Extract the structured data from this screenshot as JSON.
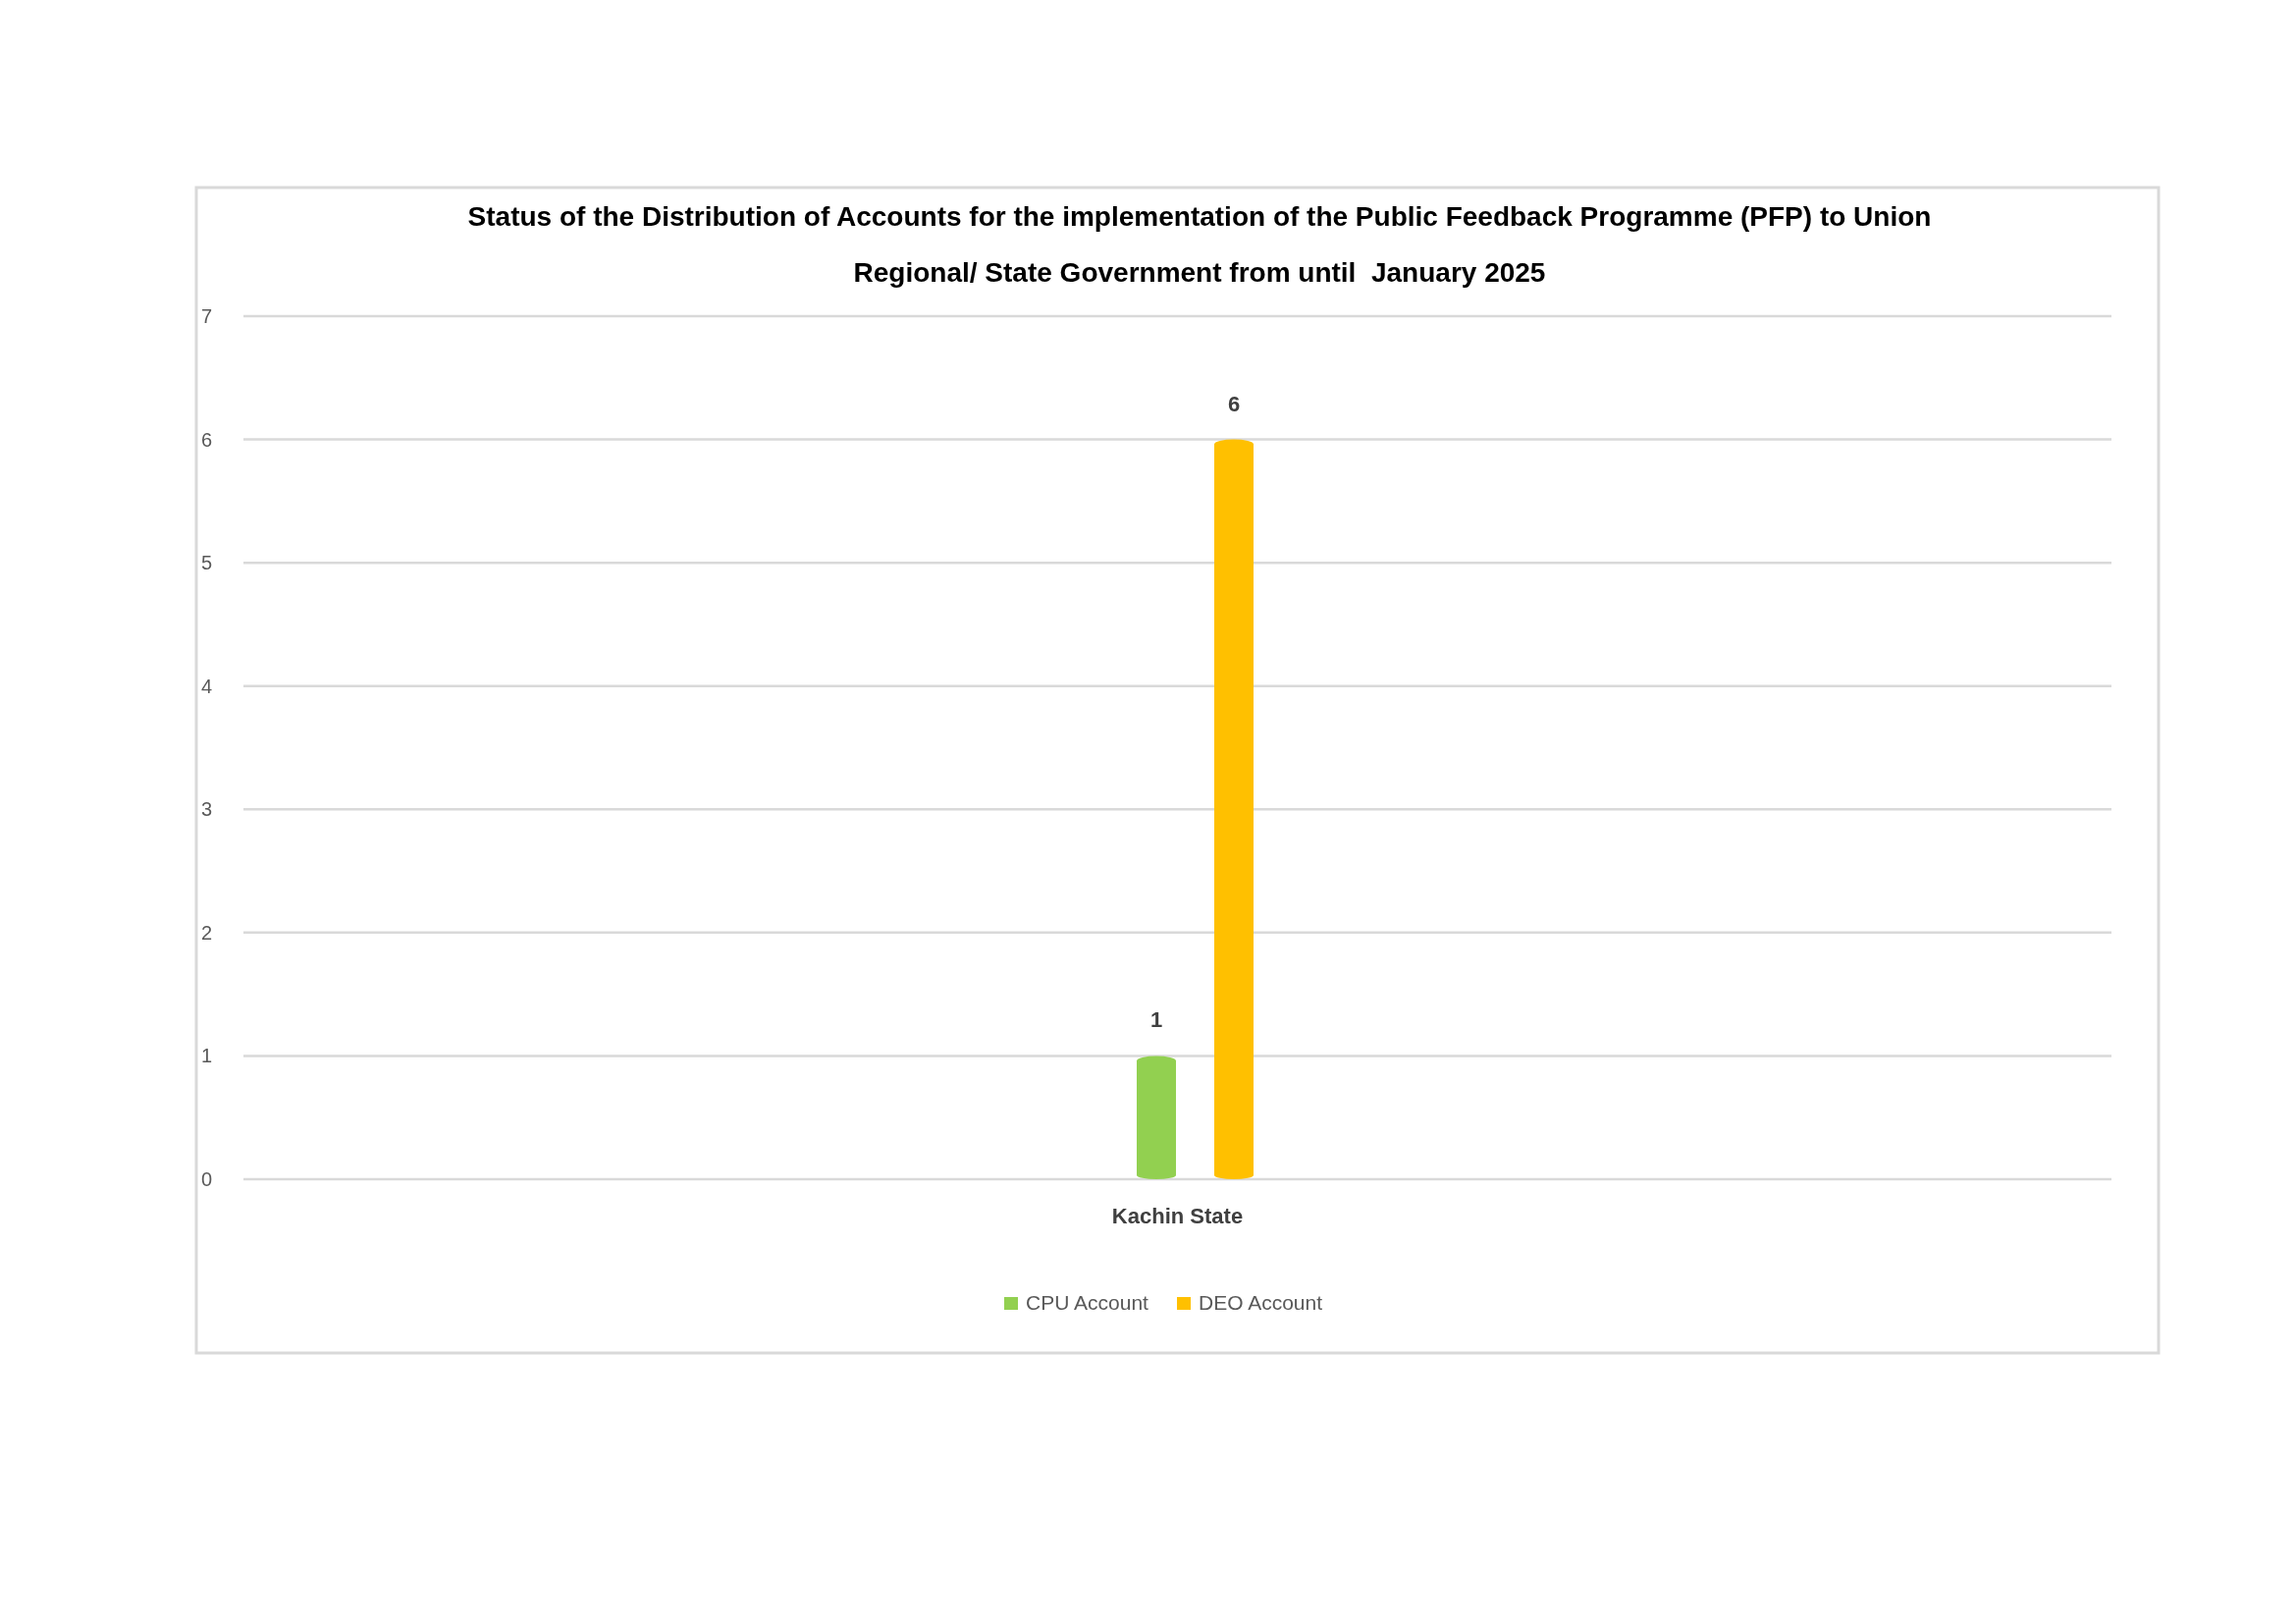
{
  "chart_data": {
    "type": "bar",
    "title": [
      "Status of the Distribution of Accounts for the implementation of the Public Feedback Programme (PFP) to Union",
      "Regional/ State Government from until  January 2025"
    ],
    "categories": [
      "Kachin State"
    ],
    "series": [
      {
        "name": "CPU Account",
        "color": "#92d050",
        "values": [
          1
        ]
      },
      {
        "name": "DEO Account",
        "color": "#ffc000",
        "values": [
          6
        ]
      }
    ],
    "ylim": [
      0,
      7
    ],
    "yticks": [
      0,
      1,
      2,
      3,
      4,
      5,
      6,
      7
    ],
    "grid": true,
    "legend": "bottom",
    "data_labels": true
  }
}
